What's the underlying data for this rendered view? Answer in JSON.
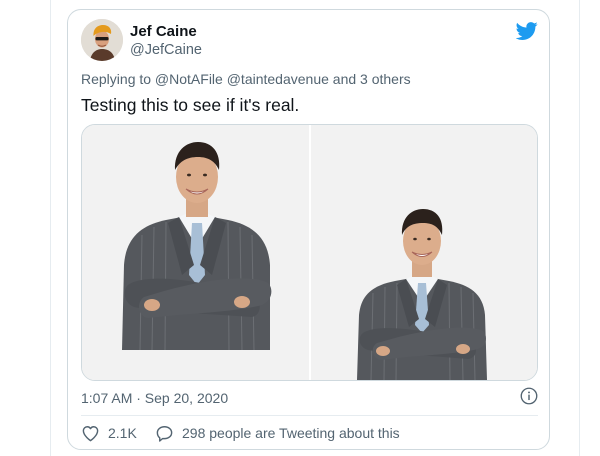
{
  "author": {
    "display_name": "Jef Caine",
    "handle": "@JefCaine"
  },
  "tweet": {
    "reply_context": "Replying to @NotAFile @taintedavenue and 3 others",
    "text": "Testing this to see if it's real.",
    "timestamp": "1:07 AM · Sep 20, 2020"
  },
  "stats": {
    "likes": "2.1K",
    "talking": "298 people are Tweeting about this"
  },
  "icons": {
    "brand": "twitter-bird-icon",
    "info": "info-icon",
    "like": "heart-icon",
    "talk": "speech-bubble-icon"
  },
  "colors": {
    "brand": "#1d9bf0",
    "text": "#0f1419",
    "secondary": "#536471",
    "border": "#cfd9de"
  }
}
